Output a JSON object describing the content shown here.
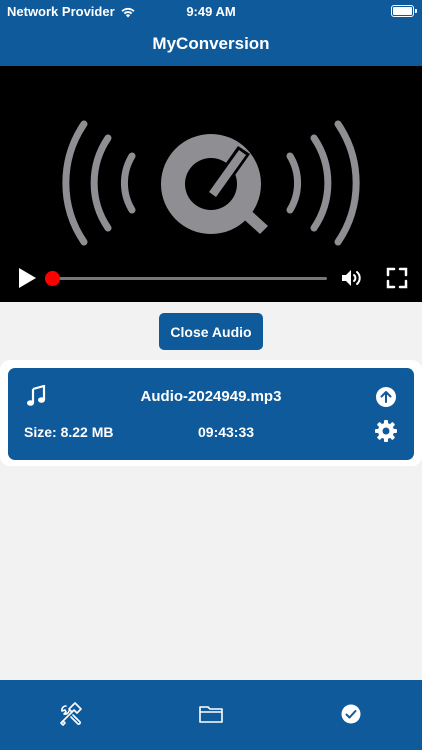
{
  "status_bar": {
    "carrier": "Network Provider",
    "time": "9:49 AM",
    "wifi_icon": "wifi-icon",
    "battery_icon": "battery-icon"
  },
  "header": {
    "title": "MyConversion"
  },
  "player": {
    "logo_icon": "quicktime-audio-logo",
    "play_icon": "play-icon",
    "progress": 0.0,
    "volume_icon": "speaker-icon",
    "fullscreen_icon": "fullscreen-icon"
  },
  "actions": {
    "close_audio_label": "Close Audio"
  },
  "file_card": {
    "icon": "music-note-icon",
    "file_name": "Audio-2024949.mp3",
    "size_text": "Size: 8.22 MB",
    "duration": "09:43:33",
    "upload_icon": "upload-icon",
    "settings_icon": "gear-icon"
  },
  "tab_bar": {
    "tabs": [
      {
        "icon": "tools-icon"
      },
      {
        "icon": "folder-icon"
      },
      {
        "icon": "checkmark-icon"
      }
    ]
  },
  "colors": {
    "primary": "#0f5a9b",
    "background": "#f2f2f2",
    "player_bg": "#000000",
    "progress_thumb": "#ff0000"
  }
}
